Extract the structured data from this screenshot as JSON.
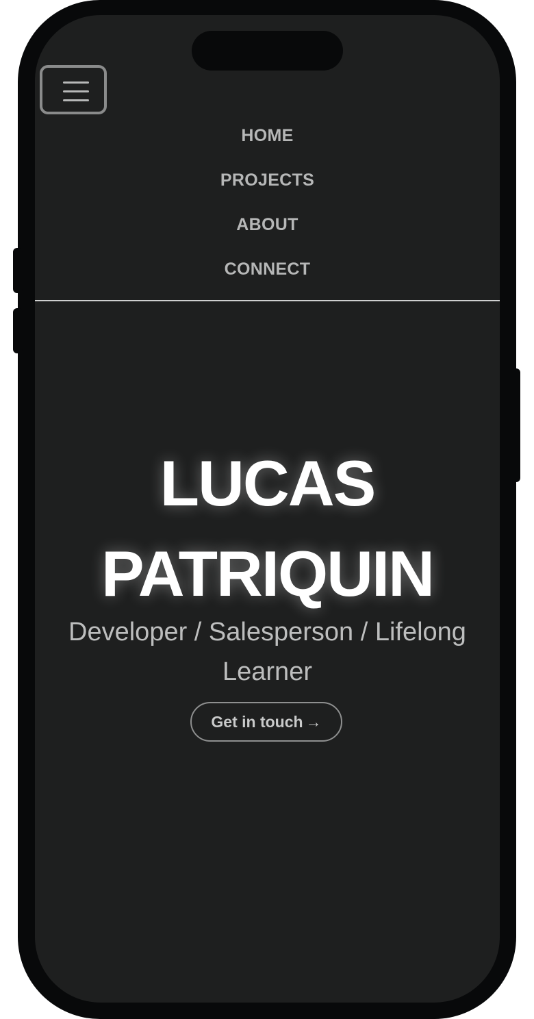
{
  "nav": {
    "menu_icon": "hamburger-icon",
    "items": [
      {
        "label": "HOME"
      },
      {
        "label": "PROJECTS"
      },
      {
        "label": "ABOUT"
      },
      {
        "label": "CONNECT"
      }
    ]
  },
  "hero": {
    "name_line1": "LUCAS",
    "name_line2": "PATRIQUIN",
    "tagline": "Developer / Salesperson / Lifelong Learner",
    "cta_label": "Get in touch",
    "cta_icon": "arrow-right-icon"
  },
  "colors": {
    "background": "#1e1f1f",
    "device_frame": "#08090a",
    "nav_text": "#b6b7b7",
    "hero_text": "#ffffff"
  }
}
